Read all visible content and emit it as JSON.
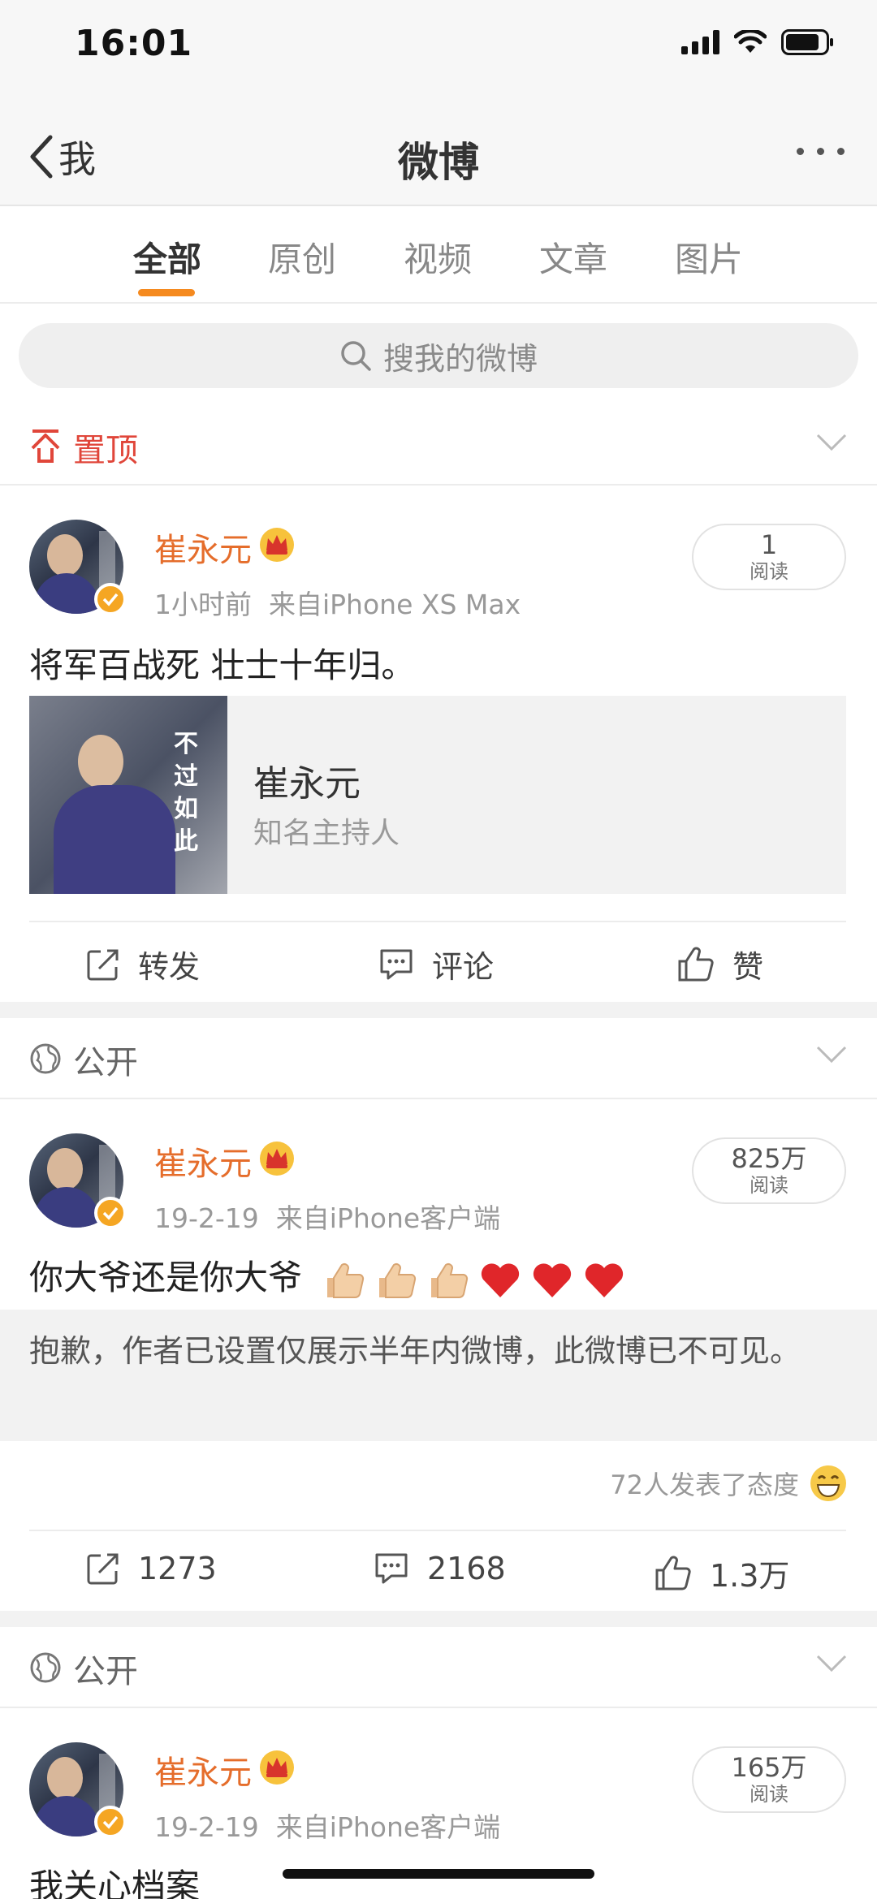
{
  "status_bar": {
    "time": "16:01"
  },
  "nav": {
    "back_label": "我",
    "title": "微博"
  },
  "tabs": [
    {
      "label": "全部",
      "active": true
    },
    {
      "label": "原创",
      "active": false
    },
    {
      "label": "视频",
      "active": false
    },
    {
      "label": "文章",
      "active": false
    },
    {
      "label": "图片",
      "active": false
    }
  ],
  "search": {
    "placeholder": "搜我的微博"
  },
  "pinned": {
    "label": "置顶"
  },
  "posts": [
    {
      "author": "崔永元",
      "time": "1小时前",
      "source": "来自iPhone XS Max",
      "reads_num": "1",
      "reads_label": "阅读",
      "text": "将军百战死  壮士十年归。",
      "card": {
        "title": "崔永元",
        "subtitle": "知名主持人",
        "image_text": "不过如此"
      },
      "actions": {
        "repost": "转发",
        "comment": "评论",
        "like": "赞"
      }
    },
    {
      "visibility": "公开",
      "author": "崔永元",
      "time": "19-2-19",
      "source": "来自iPhone客户端",
      "reads_num": "825万",
      "reads_label": "阅读",
      "text": "你大爷还是你大爷",
      "emojis": [
        "thumbs-up",
        "thumbs-up",
        "thumbs-up",
        "red-heart",
        "red-heart",
        "red-heart"
      ],
      "hidden_notice": "抱歉，作者已设置仅展示半年内微博，此微博已不可见。",
      "attitude": "72人发表了态度",
      "actions": {
        "repost": "1273",
        "comment": "2168",
        "like": "1.3万"
      }
    },
    {
      "visibility": "公开",
      "author": "崔永元",
      "time": "19-2-19",
      "source": "来自iPhone客户端",
      "reads_num": "165万",
      "reads_label": "阅读",
      "text": "我关心档案"
    }
  ],
  "colors": {
    "accent": "#f58a1f",
    "author": "#e56d2b",
    "pin": "#e0463a"
  }
}
